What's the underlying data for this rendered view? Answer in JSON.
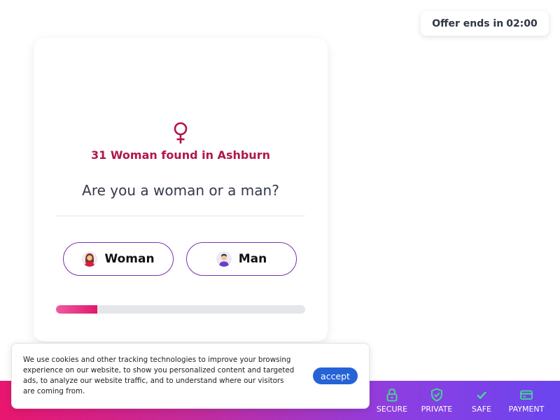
{
  "offer": {
    "label": "Offer ends in",
    "time": "02:00"
  },
  "card": {
    "icon": "venus-icon",
    "found_text": "31 Woman found in Ashburn",
    "question": "Are you a woman or a man?",
    "options": [
      {
        "label": "Woman",
        "icon": "woman-avatar-icon"
      },
      {
        "label": "Man",
        "icon": "man-avatar-icon"
      }
    ],
    "progress_fraction": 0.165
  },
  "trust_badges": [
    {
      "label": "SECURE",
      "icon": "lock-icon"
    },
    {
      "label": "PRIVATE",
      "icon": "shield-check-icon"
    },
    {
      "label": "SAFE",
      "icon": "check-icon"
    },
    {
      "label": "PAYMENT",
      "icon": "credit-card-icon"
    }
  ],
  "cookie": {
    "text": "We use cookies and other tracking technologies to improve your browsing experience on our website, to show you personalized content and targeted ads, to analyze our website traffic, and to understand where our visitors are coming from.",
    "accept_label": "accept"
  },
  "colors": {
    "accent": "#b0174a",
    "option_border": "#7b2fb0",
    "progress": "#e0186e",
    "badge_icon": "#3ee08a",
    "accept_button": "#2563d6",
    "bar_gradient": [
      "#e8166e",
      "#6b45ef"
    ]
  }
}
